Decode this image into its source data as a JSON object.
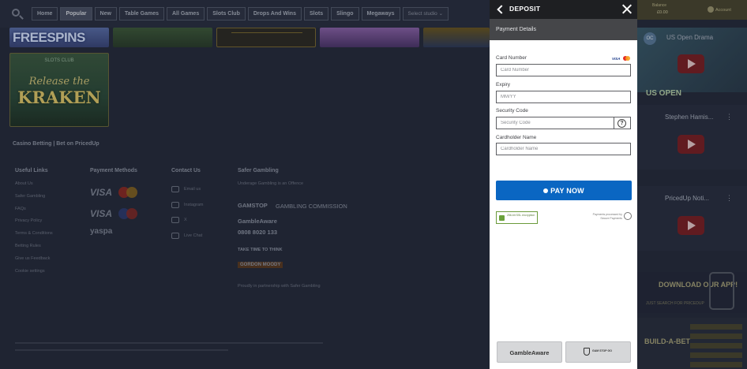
{
  "topnav": {
    "tabs": [
      "Home",
      "Popular",
      "New",
      "Table Games",
      "All Games",
      "Slots Club",
      "Drops And Wins",
      "Slots",
      "Slingo",
      "Megaways"
    ],
    "active_tab": "Popular",
    "studio_placeholder": "Select studio"
  },
  "games": {
    "freespins": "FREESPINS",
    "kraken_top": "SLOTS CLUB",
    "kraken_line1": "Release the",
    "kraken_line2": "KRAKEN"
  },
  "footer": {
    "heading": "Casino Betting | Bet on PricedUp",
    "useful_links": {
      "title": "Useful Links",
      "items": [
        "About Us",
        "Safer Gambling",
        "FAQs",
        "Privacy Policy",
        "Terms & Conditions",
        "Betting Rules",
        "Give us Feedback",
        "Cookie settings"
      ]
    },
    "payment_methods": {
      "title": "Payment Methods",
      "visa": "VISA",
      "yaspa": "yaspa"
    },
    "contact_us": {
      "title": "Contact Us",
      "items": [
        "Email us",
        "Instagram",
        "X",
        "Live Chat"
      ]
    },
    "safer_gambling": {
      "title": "Safer Gambling",
      "items": [
        "Underage Gambling is an Offence",
        "GAMSTOP",
        "GAMBLING COMMISSION",
        "GambleAware",
        "0808 8020 133",
        "TAKE TIME TO THINK",
        "GORDON MOODY",
        "Proudly in partnership with Safer Gambling"
      ]
    }
  },
  "right_column": {
    "balance_label": "Balance",
    "balance_value": "£0.00",
    "account_label": "Account",
    "videos": [
      {
        "title": "US Open Drama",
        "badge": "OC",
        "overlay": "US OPEN"
      },
      {
        "title": "Stephen Hamis..."
      },
      {
        "title": "PricedUp Noti..."
      }
    ],
    "promo_app": {
      "title": "DOWNLOAD OUR APP!",
      "sub": "JUST SEARCH FOR PRICEDUP"
    },
    "promo_bab": {
      "title": "BUILD-A-BET"
    }
  },
  "deposit": {
    "title": "DEPOSIT",
    "section": "Payment Details",
    "card_number": {
      "label": "Card Number",
      "placeholder": "Card Number",
      "visa": "VISA"
    },
    "expiry": {
      "label": "Expiry",
      "placeholder": "MM/YY"
    },
    "security_code": {
      "label": "Security Code",
      "placeholder": "Security Code",
      "help": "?"
    },
    "cardholder": {
      "label": "Cardholder Name",
      "placeholder": "Cardholder Name"
    },
    "pay_button": "PAY NOW",
    "secure_badge": "256-bit SSL encryption",
    "processor_badge": "Payments processed by Secure Payments",
    "footer_buttons": [
      "GambleAware",
      "GAM STOP GO"
    ]
  },
  "colors": {
    "pay_button": "#0a66c2",
    "modal_header": "#1e1f22",
    "section_bar": "#454649",
    "page_bg": "#262b3c"
  }
}
